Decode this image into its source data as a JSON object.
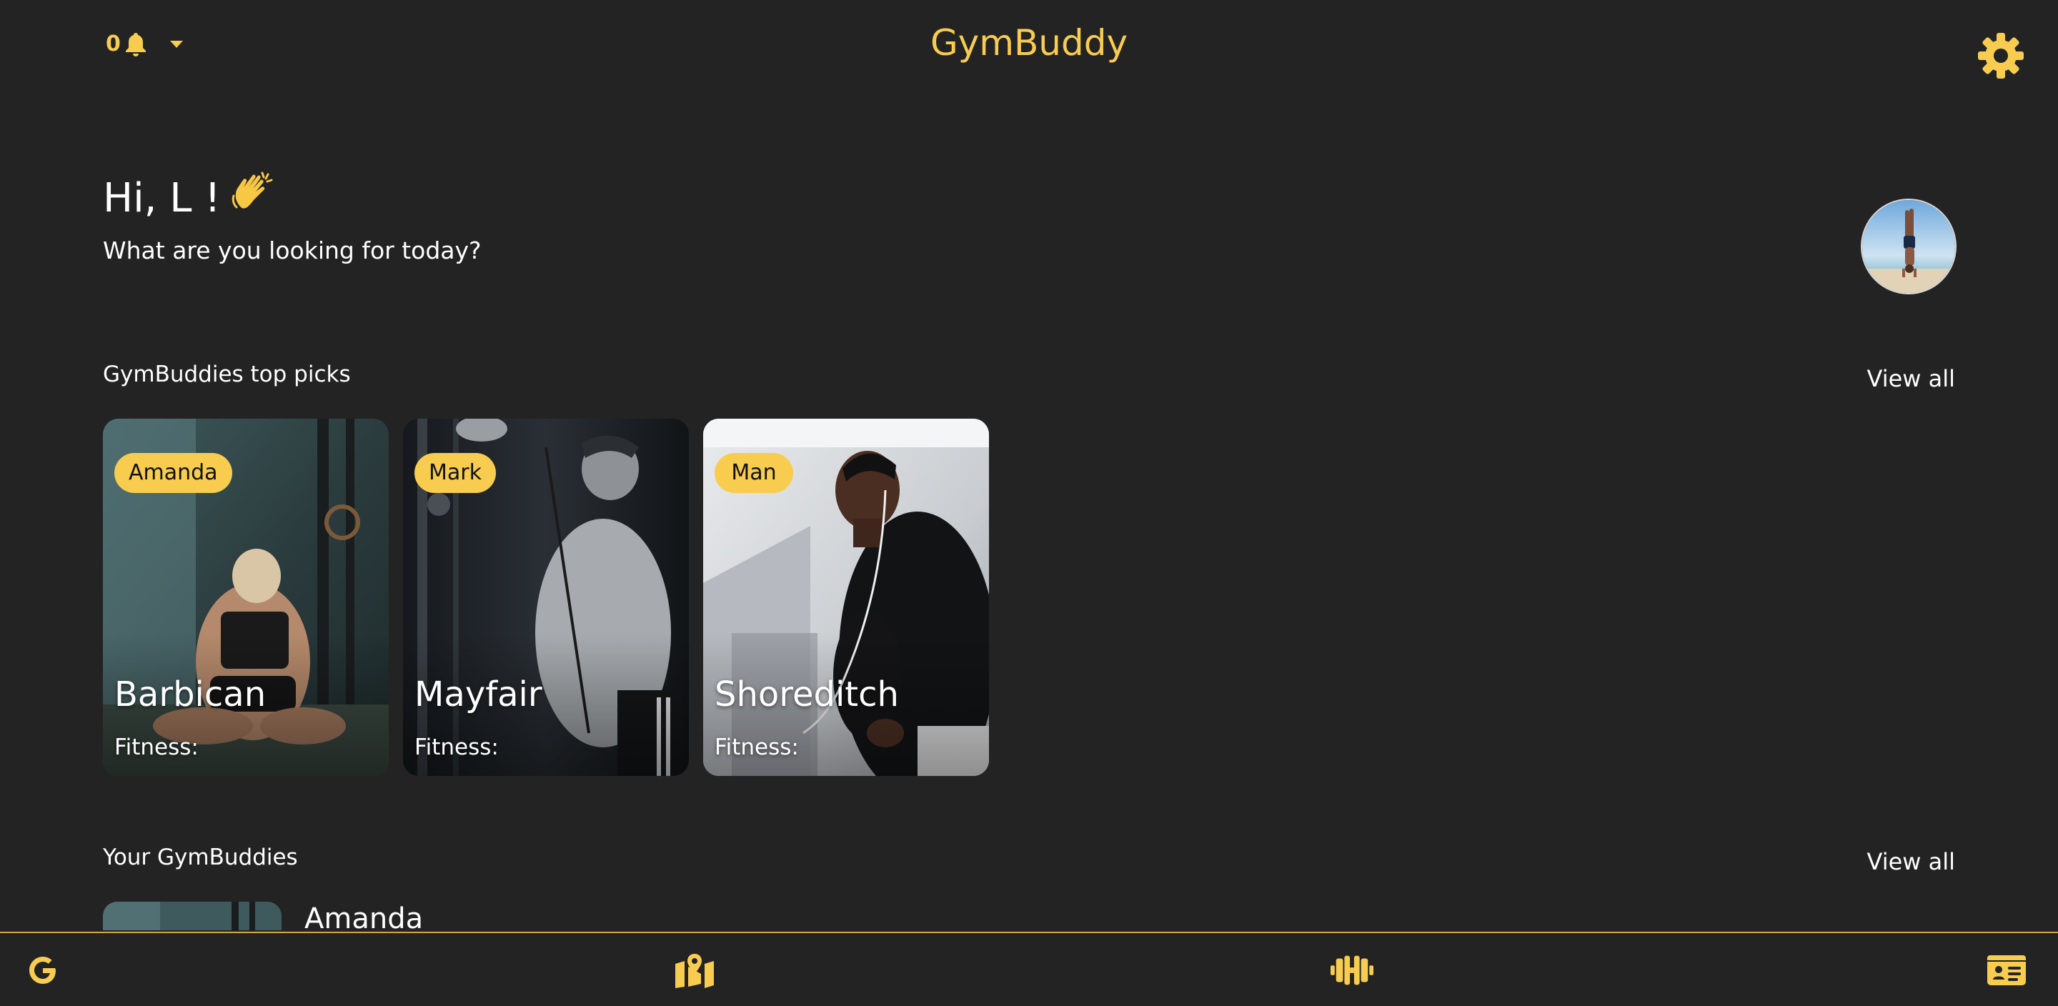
{
  "header": {
    "notification_count": "0",
    "app_title": "GymBuddy",
    "icons": {
      "bell": "bell-icon",
      "dropdown": "caret-down-icon",
      "settings": "gear-icon"
    }
  },
  "greeting": {
    "title": "Hi, L !",
    "emoji": "👋",
    "subtitle": "What are you looking for today?"
  },
  "top_picks": {
    "title": "GymBuddies top picks",
    "view_all": "View all",
    "cards": [
      {
        "name": "Amanda",
        "location": "Barbican",
        "fitness_label": "Fitness:"
      },
      {
        "name": "Mark",
        "location": "Mayfair",
        "fitness_label": "Fitness:"
      },
      {
        "name": "Man",
        "location": "Shoreditch",
        "fitness_label": "Fitness:"
      }
    ]
  },
  "your_buddies": {
    "title": "Your GymBuddies",
    "view_all": "View all",
    "items": [
      {
        "name": "Amanda"
      }
    ]
  },
  "bottom_nav": {
    "items": [
      {
        "icon": "google-g-icon"
      },
      {
        "icon": "map-location-icon"
      },
      {
        "icon": "dumbbell-icon"
      },
      {
        "icon": "id-card-icon"
      }
    ]
  },
  "colors": {
    "background": "#232323",
    "accent": "#f7cc4f",
    "text": "#ffffff"
  }
}
